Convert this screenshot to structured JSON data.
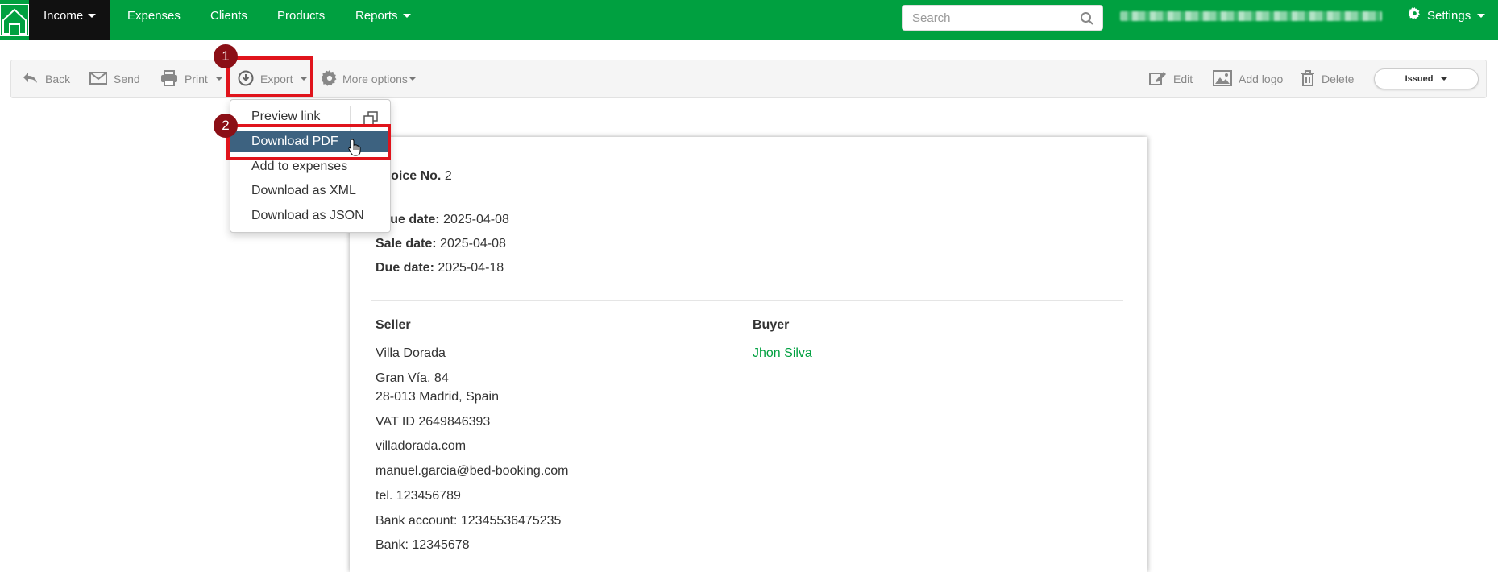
{
  "topnav": {
    "items": [
      {
        "label": "Income",
        "active": true
      },
      {
        "label": "Expenses"
      },
      {
        "label": "Clients"
      },
      {
        "label": "Products"
      },
      {
        "label": "Reports"
      }
    ],
    "search_placeholder": "Search",
    "settings_label": "Settings",
    "brand_color": "#00a040"
  },
  "toolbar": {
    "back": "Back",
    "send": "Send",
    "print": "Print",
    "export": "Export",
    "more_options": "More options",
    "edit": "Edit",
    "add_logo": "Add logo",
    "delete": "Delete",
    "status": "Issued"
  },
  "annotations": {
    "step1": "1",
    "step2": "2",
    "highlight_color": "#e0141c"
  },
  "export_menu": {
    "items": [
      "Preview link",
      "Download PDF",
      "Add to expenses",
      "Download as XML",
      "Download as JSON"
    ],
    "active_index": 1
  },
  "invoice": {
    "number_label": "Invoice No.",
    "number": "2",
    "issue_date_label": "Issue date:",
    "issue_date": "2025-04-08",
    "sale_date_label": "Sale date:",
    "sale_date": "2025-04-08",
    "due_date_label": "Due date:",
    "due_date": "2025-04-18",
    "seller_heading": "Seller",
    "buyer_heading": "Buyer",
    "seller_lines": [
      "Villa Dorada",
      "Gran Vía, 84",
      "28-013 Madrid, Spain",
      "VAT ID 2649846393",
      "villadorada.com",
      "manuel.garcia@bed-booking.com",
      "tel. 123456789",
      "Bank account: 12345536475235",
      "Bank: 12345678"
    ],
    "buyer_name": "Jhon Silva"
  }
}
